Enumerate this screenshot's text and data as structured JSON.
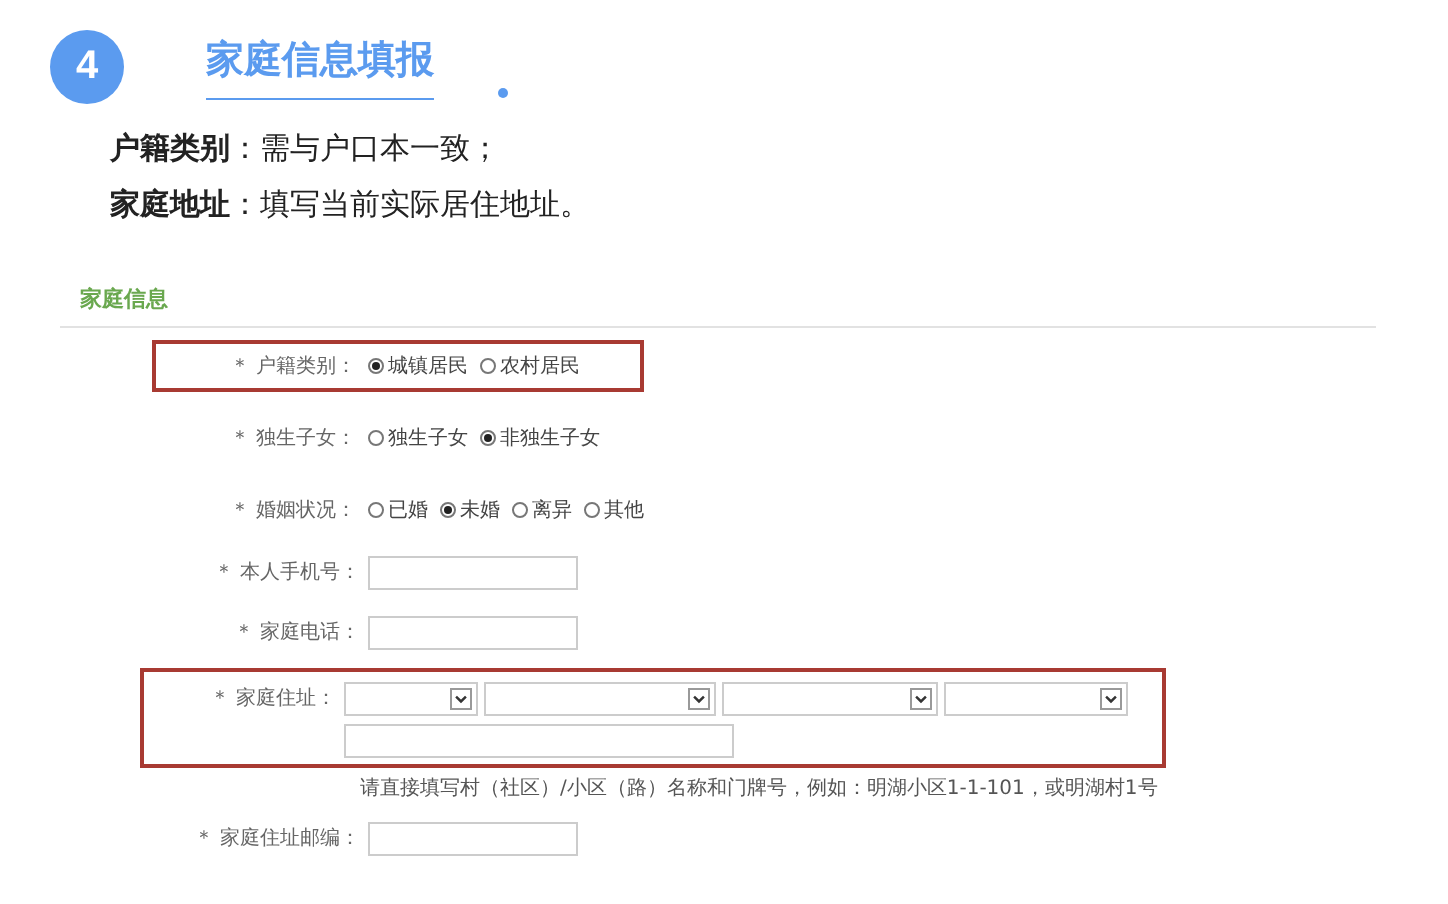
{
  "step": {
    "number": "4",
    "title": "家庭信息填报"
  },
  "notes": [
    "**户籍类别**：需与户口本一致；",
    "**家庭地址**：填写当前实际居住地址。"
  ],
  "form": {
    "section_title": "家庭信息",
    "fields": [
      {
        "kind": "radio",
        "label": "＊ 户籍类别：",
        "highlighted": true,
        "options": [
          {
            "label": "城镇居民",
            "selected": true
          },
          {
            "label": "农村居民",
            "selected": false
          }
        ]
      },
      {
        "kind": "radio",
        "label": "＊ 独生子女：",
        "highlighted": false,
        "options": [
          {
            "label": "独生子女",
            "selected": false
          },
          {
            "label": "非独生子女",
            "selected": true
          }
        ]
      },
      {
        "kind": "radio",
        "label": "＊ 婚姻状况：",
        "highlighted": false,
        "options": [
          {
            "label": "已婚",
            "selected": false
          },
          {
            "label": "未婚",
            "selected": true
          },
          {
            "label": "离异",
            "selected": false
          },
          {
            "label": "其他",
            "selected": false
          }
        ]
      },
      {
        "kind": "text",
        "label": "＊ 本人手机号："
      },
      {
        "kind": "text",
        "label": "＊ 家庭电话："
      },
      {
        "kind": "address",
        "label": "＊ 家庭住址：",
        "highlighted": true,
        "hint": "请直接填写村（社区）/小区（路）名称和门牌号，例如：明湖小区1-1-101，或明湖村1号"
      },
      {
        "kind": "text",
        "label": "＊ 家庭住址邮编："
      }
    ]
  }
}
